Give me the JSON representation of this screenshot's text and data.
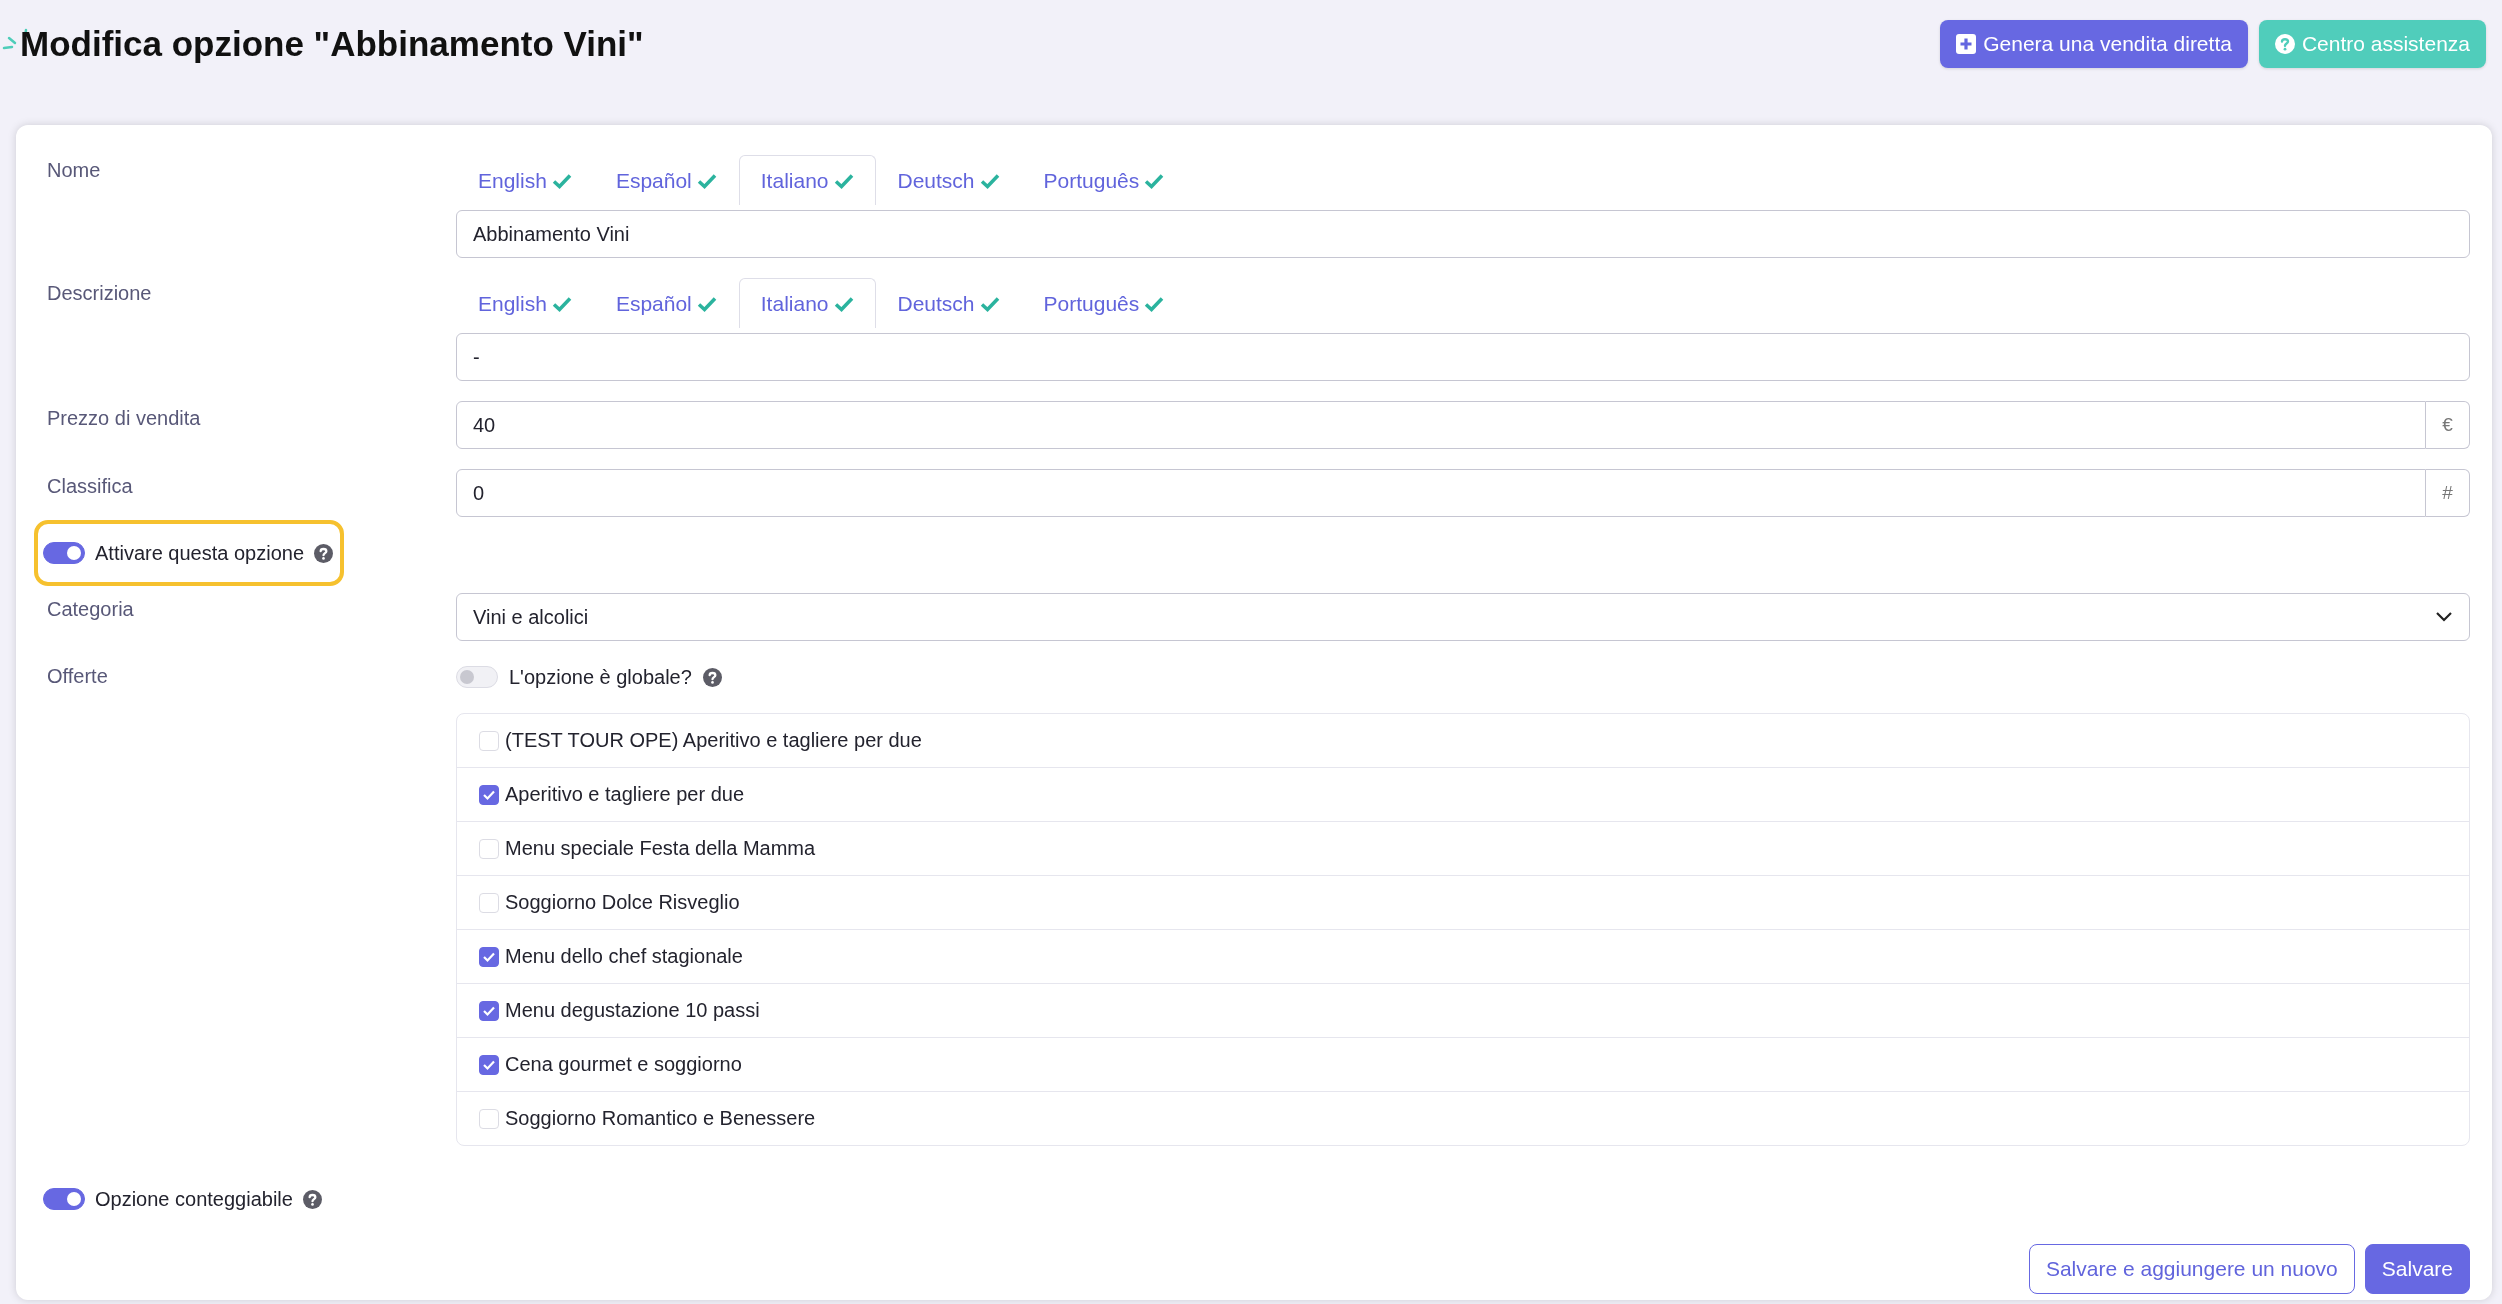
{
  "page": {
    "title": "Modifica opzione \"Abbinamento Vini\""
  },
  "header_buttons": [
    {
      "label": "Genera una vendita diretta",
      "kind": "primary"
    },
    {
      "label": "Centro assistenza",
      "kind": "info"
    }
  ],
  "form": {
    "rows": [
      {
        "kind": "translated",
        "label": "Nome",
        "tabs": [
          {
            "label": "English",
            "selected": false
          },
          {
            "label": "Español",
            "selected": false
          },
          {
            "label": "Italiano",
            "selected": true
          },
          {
            "label": "Deutsch",
            "selected": false
          },
          {
            "label": "Português",
            "selected": false
          }
        ],
        "value": "Abbinamento Vini"
      },
      {
        "kind": "translated",
        "label": "Descrizione",
        "tabs": [
          {
            "label": "English",
            "selected": false
          },
          {
            "label": "Español",
            "selected": false
          },
          {
            "label": "Italiano",
            "selected": true
          },
          {
            "label": "Deutsch",
            "selected": false
          },
          {
            "label": "Português",
            "selected": false
          }
        ],
        "value": "-"
      },
      {
        "kind": "addon",
        "label": "Prezzo di vendita",
        "value": "40",
        "addon": "€"
      },
      {
        "kind": "addon",
        "label": "Classifica",
        "value": "0",
        "addon": "#"
      },
      {
        "kind": "toggle",
        "label": "Attivare questa opzione",
        "on": true,
        "highlighted": true
      },
      {
        "kind": "select",
        "label": "Categoria",
        "value": "Vini e alcolici"
      },
      {
        "kind": "offers",
        "label": "Offerte",
        "global_toggle": {
          "label": "L'opzione è globale?",
          "on": false
        },
        "items": [
          {
            "label": "(TEST TOUR OPE) Aperitivo e tagliere per due",
            "checked": false
          },
          {
            "label": "Aperitivo e tagliere per due",
            "checked": true
          },
          {
            "label": "Menu speciale Festa della Mamma",
            "checked": false
          },
          {
            "label": "Soggiorno Dolce Risveglio",
            "checked": false
          },
          {
            "label": "Menu dello chef stagionale",
            "checked": true
          },
          {
            "label": "Menu degustazione 10 passi",
            "checked": true
          },
          {
            "label": "Cena gourmet e soggiorno",
            "checked": true
          },
          {
            "label": "Soggiorno Romantico e Benessere",
            "checked": false
          }
        ]
      },
      {
        "kind": "toggle",
        "label": "Opzione conteggiabile",
        "on": true,
        "highlighted": false
      }
    ]
  },
  "footer_buttons": [
    {
      "label": "Salvare e aggiungere un nuovo",
      "kind": "outline"
    },
    {
      "label": "Salvare",
      "kind": "primary"
    }
  ]
}
